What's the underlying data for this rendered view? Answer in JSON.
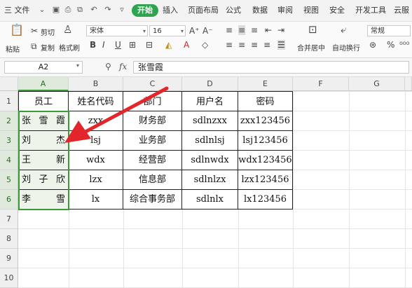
{
  "menubar": {
    "file_label": "三 文件",
    "items": [
      "开始",
      "插入",
      "页面布局",
      "公式",
      "数据",
      "审阅",
      "视图",
      "安全",
      "开发工具",
      "云服"
    ]
  },
  "ribbon": {
    "paste": "粘贴",
    "cut": "剪切",
    "copy": "复制",
    "format_painter": "格式刷",
    "font_name": "宋体",
    "font_size": "16",
    "merge_center": "合并居中",
    "wrap_text": "自动换行",
    "number_format": "常规",
    "percent": "%"
  },
  "formula_bar": {
    "name_box": "A2",
    "fx": "fx",
    "value": "张雪霞"
  },
  "columns": [
    "A",
    "B",
    "C",
    "D",
    "E",
    "F",
    "G"
  ],
  "rows": [
    "1",
    "2",
    "3",
    "4",
    "5",
    "6",
    "7",
    "8",
    "9",
    "10"
  ],
  "table": {
    "headers": [
      "员工",
      "姓名代码",
      "部门",
      "用户名",
      "密码"
    ],
    "rows": [
      [
        "张 雪 霞",
        "zxx",
        "财务部",
        "sdlnzxx",
        "zxx123456"
      ],
      [
        "刘 杰",
        "lsj",
        "业务部",
        "sdlnlsj",
        "lsj123456"
      ],
      [
        "王 新",
        "wdx",
        "经营部",
        "sdlnwdx",
        "wdx123456"
      ],
      [
        "刘 子 欣",
        "lzx",
        "信息部",
        "sdlnlzx",
        "lzx123456"
      ],
      [
        "李 雪",
        "lx",
        "综合事务部",
        "sdlnlx",
        "lx123456"
      ]
    ]
  },
  "colors": {
    "accent": "#2ea44f",
    "selection": "#3a9a3a",
    "arrow": "#e3262b"
  }
}
